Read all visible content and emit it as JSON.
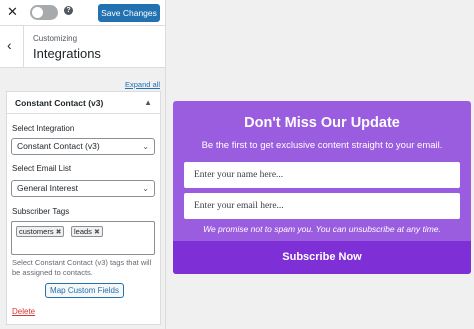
{
  "topbar": {
    "close_icon": "close-icon",
    "help_glyph": "?",
    "save_label": "Save Changes"
  },
  "header": {
    "breadcrumb": "Customizing",
    "title": "Integrations"
  },
  "expand_label": "Expand all",
  "section": {
    "title": "Constant Contact (v3)",
    "integration_label": "Select Integration",
    "integration_value": "Constant Contact (v3)",
    "email_list_label": "Select Email List",
    "email_list_value": "General Interest",
    "tags_label": "Subscriber Tags",
    "tags": [
      "customers",
      "leads"
    ],
    "help_text": "Select Constant Contact (v3) tags that will be assigned to contacts.",
    "map_button": "Map Custom Fields",
    "delete_label": "Delete"
  },
  "optin": {
    "title": "Don't Miss Our Update",
    "subtitle": "Be the first to get exclusive content straight to your email.",
    "name_placeholder": "Enter your name here...",
    "email_placeholder": "Enter your email here...",
    "privacy": "We promise not to spam you. You can unsubscribe at any time.",
    "button": "Subscribe Now",
    "colors": {
      "background": "#9b5de0",
      "button": "#7e2fd6"
    }
  }
}
